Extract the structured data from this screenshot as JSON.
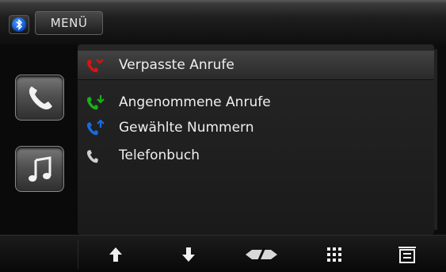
{
  "topbar": {
    "menu_label": "MENÜ"
  },
  "sidebar": {
    "buttons": [
      {
        "icon": "phone-icon"
      },
      {
        "icon": "music-note-icon"
      }
    ]
  },
  "call_list": {
    "items": [
      {
        "label": "Verpasste Anrufe",
        "icon": "missed-call-icon",
        "color": "#e01010",
        "selected": true
      },
      {
        "label": "Angenommene Anrufe",
        "icon": "received-call-icon",
        "color": "#18b018",
        "selected": false
      },
      {
        "label": "Gewählte Nummern",
        "icon": "dialed-call-icon",
        "color": "#1a6ae0",
        "selected": false
      },
      {
        "label": "Telefonbuch",
        "icon": "phonebook-icon",
        "color": "#cfcfcf",
        "selected": false
      }
    ]
  },
  "bottombar": {
    "buttons": [
      {
        "icon": "arrow-up-icon"
      },
      {
        "icon": "arrow-down-icon"
      },
      {
        "icon": "hang-up-icon"
      },
      {
        "icon": "keypad-icon"
      },
      {
        "icon": "list-icon"
      }
    ]
  },
  "colors": {
    "accent_blue": "#0a4bc2"
  }
}
